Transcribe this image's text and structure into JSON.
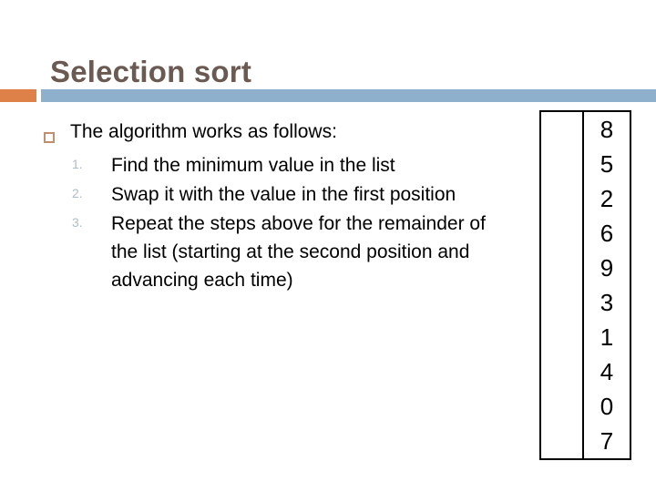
{
  "slide": {
    "title": "Selection sort",
    "theme": {
      "accent_orange": "#dd8148",
      "accent_blue": "#8fb0cd",
      "title_color": "#6b5a52",
      "bullet_marker_color": "#c08f6d",
      "number_color": "#aebdc9",
      "body_text_color": "#000000"
    },
    "body": {
      "bullet": {
        "marker": "hollow-square-bullet",
        "text": "The algorithm works as follows:"
      },
      "steps": [
        {
          "number": "1.",
          "text": "Find the minimum value in the list"
        },
        {
          "number": "2.",
          "text": "Swap it with the value in the first position"
        },
        {
          "number": "3.",
          "text": "Repeat the steps above for the remainder of the list (starting at the second position and advancing each time)"
        }
      ]
    },
    "value_table": {
      "left_column": [
        "",
        "",
        "",
        "",
        "",
        "",
        "",
        "",
        "",
        ""
      ],
      "right_column": [
        "8",
        "5",
        "2",
        "6",
        "9",
        "3",
        "1",
        "4",
        "0",
        "7"
      ]
    }
  }
}
